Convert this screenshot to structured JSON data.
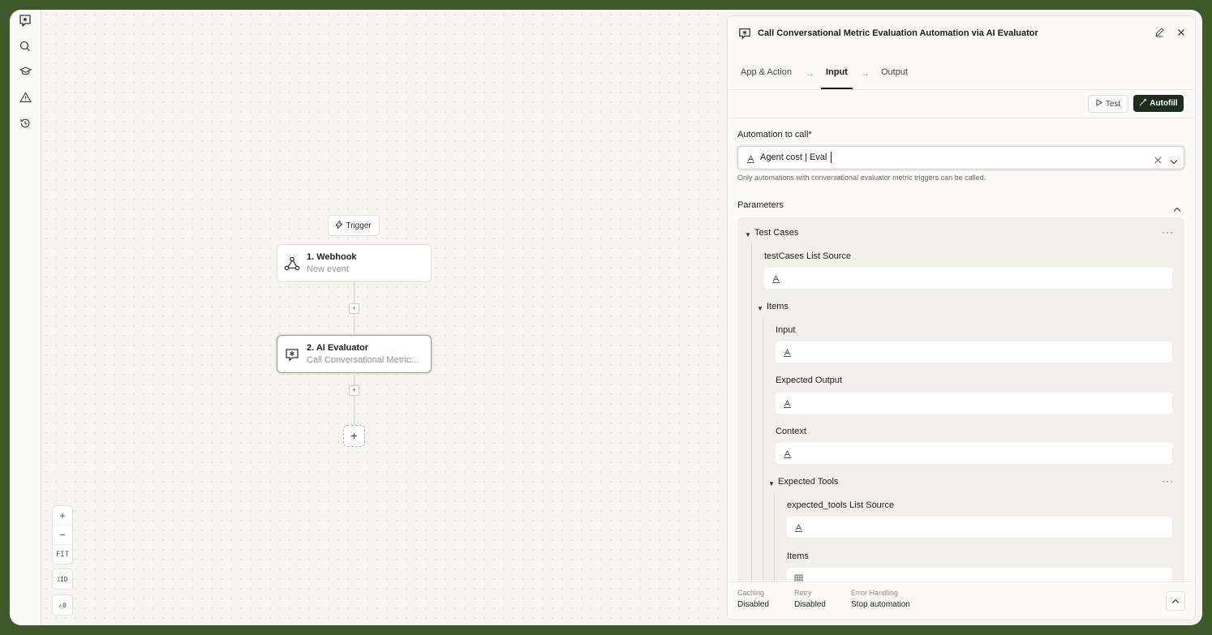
{
  "rail": {
    "icons": [
      "logo-icon",
      "search-icon",
      "graduation-cap-icon",
      "warning-icon",
      "history-icon"
    ]
  },
  "canvas": {
    "trigger_label": "Trigger",
    "nodes": [
      {
        "title": "1. Webhook",
        "subtitle": "New event",
        "icon": "webhook-icon"
      },
      {
        "title": "2. AI Evaluator",
        "subtitle": "Call Conversational Metric…",
        "icon": "ai-evaluator-icon"
      }
    ],
    "add_step_symbol": "+",
    "small_plus": "+",
    "zoom": {
      "in": "+",
      "out": "−",
      "fit": "FIT"
    },
    "id_toggle": "⁒ID",
    "warnings": "⚠0"
  },
  "panel": {
    "title": "Call Conversational Metric Evaluation Automation via AI Evaluator",
    "tabs": [
      {
        "label": "App & Action",
        "active": false
      },
      {
        "label": "Input",
        "active": true
      },
      {
        "label": "Output",
        "active": false
      }
    ],
    "test_label": "Test",
    "autofill_label": "Autofill",
    "automation_label": "Automation to call*",
    "automation_value": "Agent cost | Eval",
    "automation_hint": "Only automations with conversational evaluator metric triggers can be called.",
    "parameters_label": "Parameters",
    "test_cases_label": "Test Cases",
    "testcases_source_label": "testCases List Source",
    "items_label": "Items",
    "input_label": "Input",
    "expected_output_label": "Expected Output",
    "context_label": "Context",
    "expected_tools_label": "Expected Tools",
    "expected_tools_source_label": "expected_tools List Source",
    "tools_items_label": "Items",
    "footer": {
      "caching_key": "Caching",
      "caching_val": "Disabled",
      "retry_key": "Retry",
      "retry_val": "Disabled",
      "error_key": "Error Handling",
      "error_val": "Stop automation"
    },
    "accent": "#1d2e1a"
  }
}
